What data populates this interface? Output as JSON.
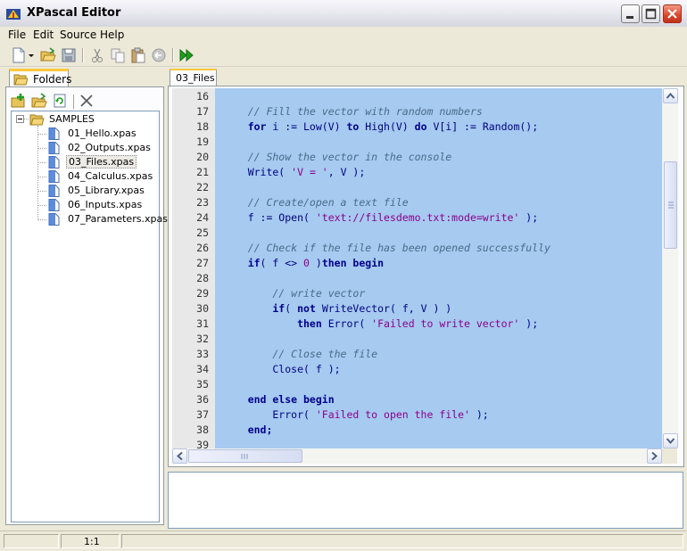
{
  "window": {
    "title": "XPascal Editor"
  },
  "menu": [
    "File",
    "Edit",
    "Source",
    "Help"
  ],
  "toolbar": {
    "icons": [
      "new-file-icon",
      "dropdown-arrow-icon",
      "open-folder-icon",
      "save-icon",
      "cut-icon",
      "copy-icon",
      "paste-icon",
      "undo-icon",
      "run-icon"
    ]
  },
  "left_panel": {
    "tab_label": "Folders",
    "actions": [
      "add-folder-icon",
      "open-folder-icon",
      "refresh-icon",
      "delete-icon"
    ],
    "tree": {
      "root": "SAMPLES",
      "files": [
        "01_Hello.xpas",
        "02_Outputs.xpas",
        "03_Files.xpas",
        "04_Calculus.xpas",
        "05_Library.xpas",
        "06_Inputs.xpas",
        "07_Parameters.xpas"
      ],
      "selected_index": 2
    }
  },
  "editor": {
    "tab_label": "03_Files",
    "lines": [
      {
        "n": "16",
        "tokens": []
      },
      {
        "n": "17",
        "tokens": [
          [
            "cm",
            "    // Fill the vector with random numbers"
          ]
        ]
      },
      {
        "n": "18",
        "tokens": [
          [
            "kw",
            "    for"
          ],
          [
            "tx",
            " i := Low(V) "
          ],
          [
            "kw",
            "to"
          ],
          [
            "tx",
            " High(V) "
          ],
          [
            "kw",
            "do"
          ],
          [
            "tx",
            " V[i] := Random();"
          ]
        ]
      },
      {
        "n": "19",
        "tokens": []
      },
      {
        "n": "20",
        "tokens": [
          [
            "cm",
            "    // Show the vector in the console"
          ]
        ]
      },
      {
        "n": "21",
        "tokens": [
          [
            "tx",
            "    Write( "
          ],
          [
            "st",
            "'V = '"
          ],
          [
            "tx",
            ", V );"
          ]
        ]
      },
      {
        "n": "22",
        "tokens": []
      },
      {
        "n": "23",
        "tokens": [
          [
            "cm",
            "    // Create/open a text file"
          ]
        ]
      },
      {
        "n": "24",
        "tokens": [
          [
            "tx",
            "    f := Open( "
          ],
          [
            "st",
            "'text://filesdemo.txt:mode=write'"
          ],
          [
            "tx",
            " );"
          ]
        ]
      },
      {
        "n": "25",
        "tokens": []
      },
      {
        "n": "26",
        "tokens": [
          [
            "cm",
            "    // Check if the file has been opened successfully"
          ]
        ]
      },
      {
        "n": "27",
        "tokens": [
          [
            "kw",
            "    if"
          ],
          [
            "tx",
            "( f <> "
          ],
          [
            "nm",
            "0"
          ],
          [
            "tx",
            " )"
          ],
          [
            "kw",
            "then begin"
          ]
        ]
      },
      {
        "n": "28",
        "tokens": []
      },
      {
        "n": "29",
        "tokens": [
          [
            "cm",
            "        // write vector"
          ]
        ]
      },
      {
        "n": "30",
        "tokens": [
          [
            "kw",
            "        if"
          ],
          [
            "tx",
            "( "
          ],
          [
            "kw",
            "not"
          ],
          [
            "tx",
            " WriteVector( f, V ) )"
          ]
        ]
      },
      {
        "n": "31",
        "tokens": [
          [
            "kw",
            "            then"
          ],
          [
            "tx",
            " Error( "
          ],
          [
            "st",
            "'Failed to write vector'"
          ],
          [
            "tx",
            " );"
          ]
        ]
      },
      {
        "n": "32",
        "tokens": []
      },
      {
        "n": "33",
        "tokens": [
          [
            "cm",
            "        // Close the file"
          ]
        ]
      },
      {
        "n": "34",
        "tokens": [
          [
            "tx",
            "        Close( f );"
          ]
        ]
      },
      {
        "n": "35",
        "tokens": []
      },
      {
        "n": "36",
        "tokens": [
          [
            "kw",
            "    end else begin"
          ]
        ]
      },
      {
        "n": "37",
        "tokens": [
          [
            "tx",
            "        Error( "
          ],
          [
            "st",
            "'Failed to open the file'"
          ],
          [
            "tx",
            " );"
          ]
        ]
      },
      {
        "n": "38",
        "tokens": [
          [
            "kw",
            "    end;"
          ]
        ]
      },
      {
        "n": "39",
        "tokens": []
      }
    ]
  },
  "status": {
    "position": "1:1"
  },
  "colors": {
    "selection": "#a6caf0",
    "keyword": "#00008b",
    "comment": "#4a6a8a",
    "string": "#8b008b"
  }
}
